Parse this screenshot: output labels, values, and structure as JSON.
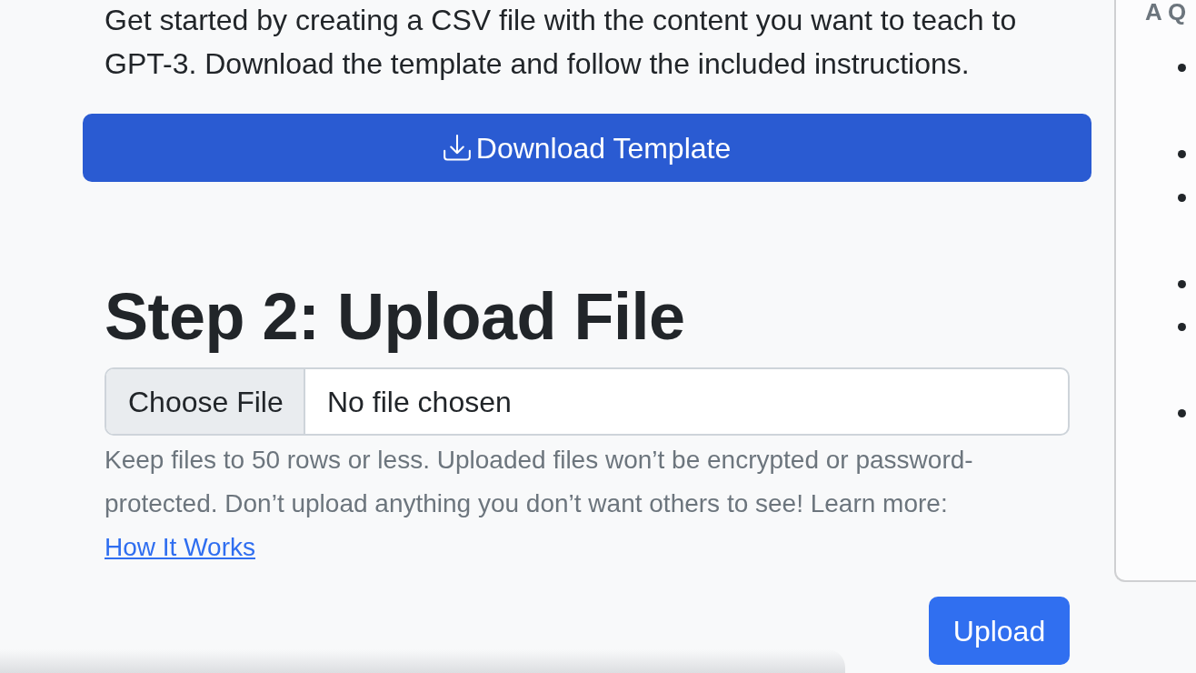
{
  "intro": {
    "text": "Get started by creating a CSV file with the content you want to teach to GPT-3. Download the template and follow the included instructions."
  },
  "download_button": {
    "label": "Download Template"
  },
  "step_heading": "Step 2: Upload File",
  "file_input": {
    "button": "Choose File",
    "status": "No file chosen"
  },
  "help_text": {
    "text": "Keep files to 50 rows or less. Uploaded files won’t be encrypted or password-protected. Don’t upload anything you don’t want others to see! Learn more:",
    "link": "How It Works"
  },
  "upload_button": {
    "label": "Upload"
  },
  "side_card": {
    "title": "A Q"
  }
}
